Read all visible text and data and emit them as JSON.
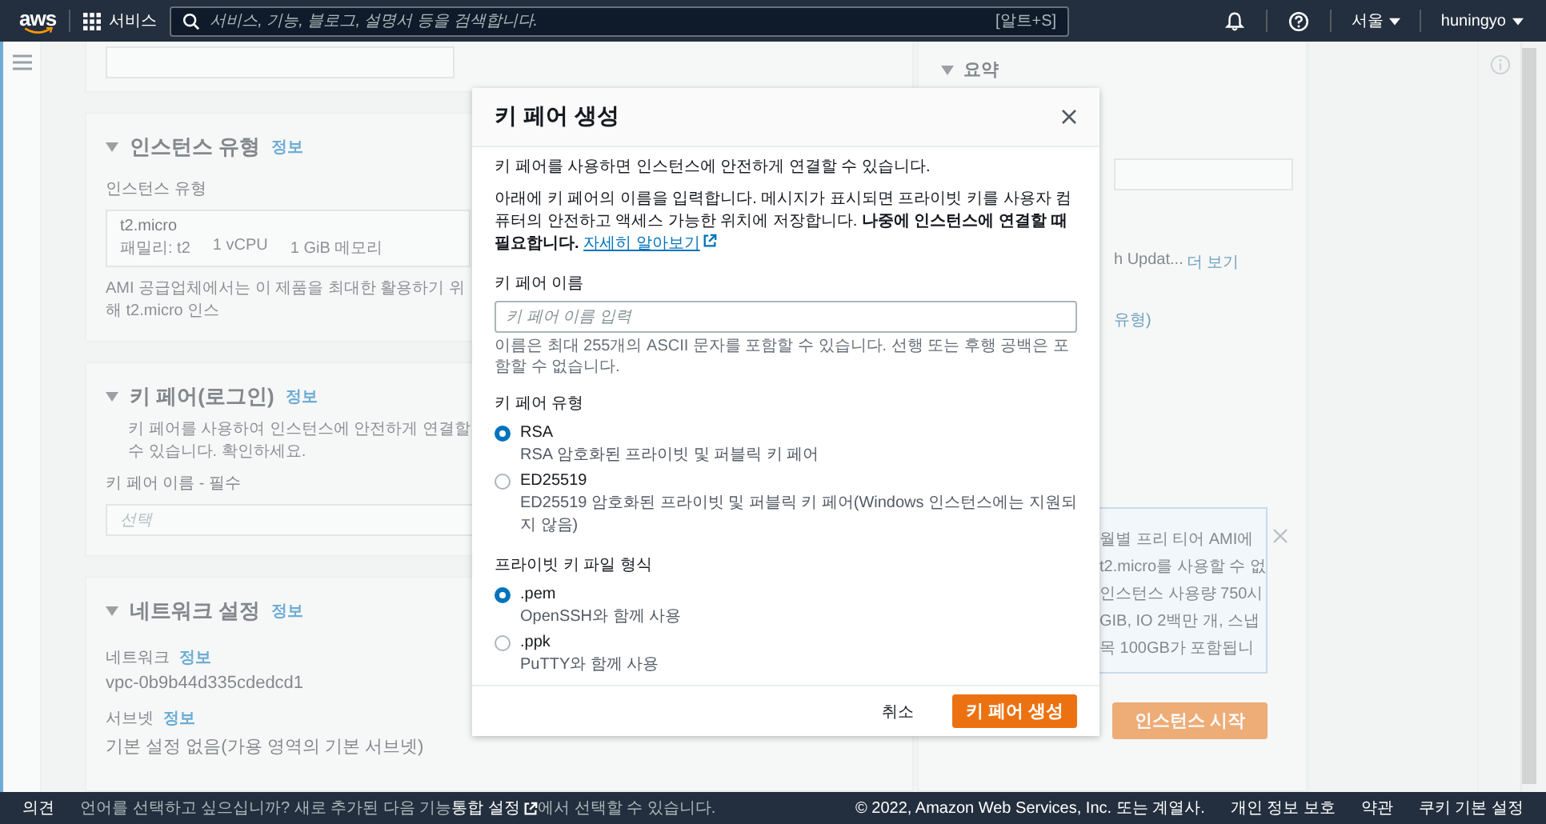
{
  "top_nav": {
    "logo": "aws",
    "services": "서비스",
    "search": {
      "placeholder": "서비스, 기능, 블로그, 설명서 등을 검색합니다.",
      "shortcut": "[알트+S]"
    },
    "region": "서울",
    "user": "huningyo"
  },
  "background": {
    "instance_type": {
      "title": "인스턴스 유형",
      "info": "정보",
      "field_label": "인스턴스 유형",
      "value": "t2.micro",
      "details": [
        "패밀리: t2",
        "1 vCPU",
        "1 GiB 메모리"
      ],
      "hint": "AMI 공급업체에서는 이 제품을 최대한 활용하기 위해 t2.micro 인스"
    },
    "key_pair": {
      "title": "키 페어(로그인)",
      "info": "정보",
      "description": "키 페어를 사용하여 인스턴스에 안전하게 연결할 수 있습니다. 확인하세요.",
      "field_label": "키 페어 이름 - 필수",
      "placeholder": "선택"
    },
    "network": {
      "title": "네트워크 설정",
      "info": "정보",
      "fields": [
        {
          "label": "네트워크",
          "info": "정보",
          "value": "vpc-0b9b44d335cdedcd1"
        },
        {
          "label": "서브넷",
          "info": "정보",
          "value": "기본 설정 없음(가용 영역의 기본 서브넷)"
        }
      ]
    },
    "summary": {
      "title": "요약",
      "image_text": "h Updat...",
      "more_link": "더 보기",
      "type_text": "유형)",
      "free_tier_lines": [
        "월별 프리 티어 AMI에",
        "t2.micro를 사용할 수 없",
        "인스턴스 사용량 750시",
        "GIB, IO 2백만 개, 스냅",
        "목 100GB가 포함됩니"
      ],
      "launch_button": "인스턴스 시작"
    }
  },
  "modal": {
    "title": "키 페어 생성",
    "intro": "키 페어를 사용하면 인스턴스에 안전하게 연결할 수 있습니다.",
    "description": "아래에 키 페어의 이름을 입력합니다. 메시지가 표시되면 프라이빗 키를 사용자 컴퓨터의 안전하고 액세스 가능한 위치에 저장합니다. **나중에 인스턴스에 연결할 때 필요합니다.**",
    "link": "자세히 알아보기",
    "name_field": {
      "label": "키 페어 이름",
      "placeholder": "키 페어 이름 입력",
      "hint": "이름은 최대 255개의 ASCII 문자를 포함할 수 있습니다. 선행 또는 후행 공백은 포함할 수 없습니다."
    },
    "radio_groups": [
      {
        "label": "키 페어 유형",
        "options": [
          {
            "label": "RSA",
            "description": "RSA 암호화된 프라이빗 및 퍼블릭 키 페어",
            "selected": true
          },
          {
            "label": "ED25519",
            "description": "ED25519 암호화된 프라이빗 및 퍼블릭 키 페어(Windows 인스턴스에는 지원되지 않음)",
            "selected": false
          }
        ]
      },
      {
        "label": "프라이빗 키 파일 형식",
        "options": [
          {
            "label": ".pem",
            "description": "OpenSSH와 함께 사용",
            "selected": true
          },
          {
            "label": ".ppk",
            "description": "PuTTY와 함께 사용",
            "selected": false
          }
        ]
      }
    ],
    "cancel_button": "취소",
    "create_button": "키 페어 생성"
  },
  "footer": {
    "feedback": "의견",
    "language_text_before": "언어를 선택하고 싶으십니까? 새로 추가된 다음 기능",
    "language_link": "통합 설정",
    "language_text_after": "에서 선택할 수 있습니다.",
    "copyright": "© 2022, Amazon Web Services, Inc. 또는 계열사.",
    "links": [
      "개인 정보 보호",
      "약관",
      "쿠키 기본 설정"
    ]
  }
}
